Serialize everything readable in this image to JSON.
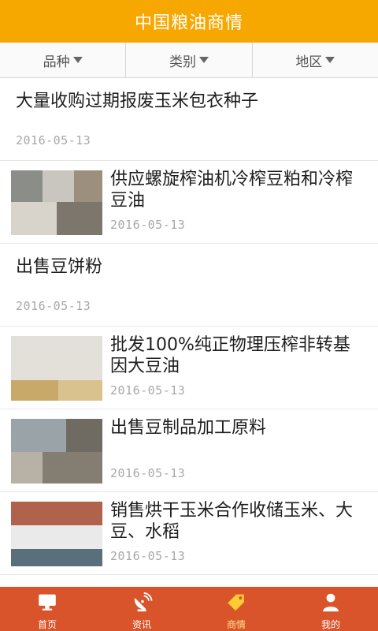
{
  "header": {
    "title": "中国粮油商情"
  },
  "filters": [
    {
      "label": "品种"
    },
    {
      "label": "类别"
    },
    {
      "label": "地区"
    }
  ],
  "items": [
    {
      "title": "大量收购过期报废玉米包衣种子",
      "date": "2016-05-13",
      "has_image": false
    },
    {
      "title": "供应螺旋榨油机冷榨豆粕和冷榨豆油",
      "date": "2016-05-13",
      "has_image": true
    },
    {
      "title": "出售豆饼粉",
      "date": "2016-05-13",
      "has_image": false
    },
    {
      "title": "批发100%纯正物理压榨非转基因大豆油",
      "date": "2016-05-13",
      "has_image": true
    },
    {
      "title": "出售豆制品加工原料",
      "date": "2016-05-13",
      "has_image": true
    },
    {
      "title": "销售烘干玉米合作收储玉米、大豆、水稻",
      "date": "2016-05-13",
      "has_image": true
    }
  ],
  "tabbar": [
    {
      "label": "首页",
      "icon": "monitor-icon",
      "active": false
    },
    {
      "label": "资讯",
      "icon": "satellite-dish-icon",
      "active": false
    },
    {
      "label": "商情",
      "icon": "tag-icon",
      "active": true
    },
    {
      "label": "我的",
      "icon": "user-icon",
      "active": false
    }
  ],
  "colors": {
    "header": "#f7a800",
    "tabbar": "#d9542a",
    "active_tab_label": "#ffe28a"
  }
}
